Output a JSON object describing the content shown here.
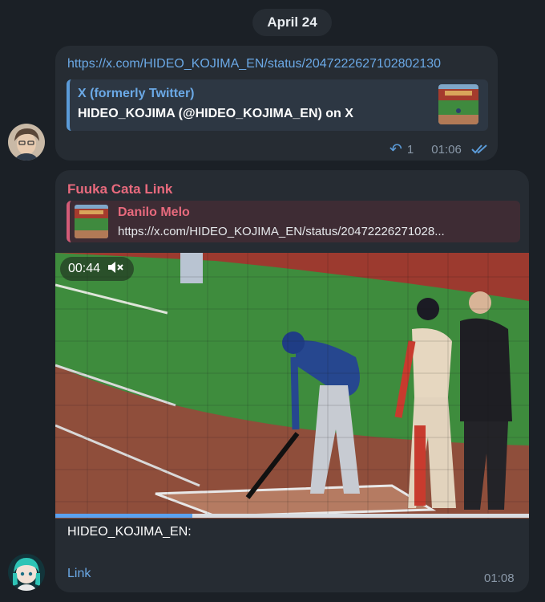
{
  "date_separator": "April 24",
  "message1": {
    "url": "https://x.com/HIDEO_KOJIMA_EN/status/2047222627102802130",
    "preview": {
      "site_name": "X (formerly Twitter)",
      "title": "HIDEO_KOJIMA (@HIDEO_KOJIMA_EN) on X",
      "thumbnail_icon": "baseball-field-thumbnail"
    },
    "reply_count": "1",
    "time": "01:06",
    "status_icon": "double-check-icon"
  },
  "message2": {
    "sender": "Fuuka Cata Link",
    "reply": {
      "author": "Danilo Melo",
      "text": "https://x.com/HIDEO_KOJIMA_EN/status/20472226271028..."
    },
    "video": {
      "duration": "00:44",
      "muted_icon": "speaker-muted-icon",
      "progress": 0.29
    },
    "caption": "HIDEO_KOJIMA_EN:",
    "link_label": "Link",
    "time": "01:08"
  },
  "colors": {
    "background": "#1b2026",
    "bubble": "#262c33",
    "link": "#6ba9e6",
    "sender": "#e86a7d",
    "meta": "#8a98a8"
  }
}
